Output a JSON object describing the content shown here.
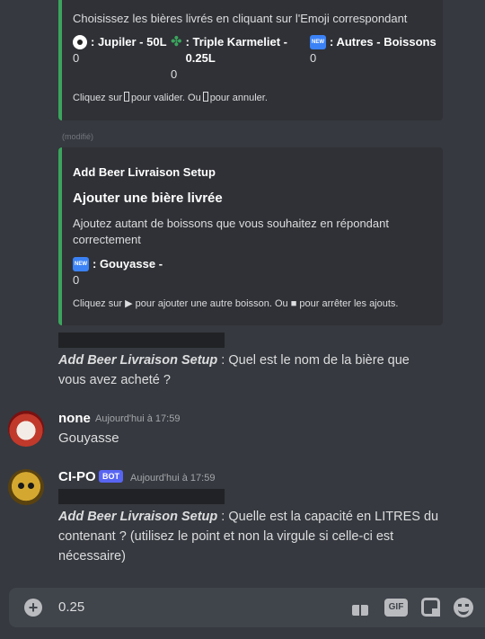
{
  "embed1": {
    "description": "Choisissez les bières livrés en cliquant sur l'Emoji correspondant",
    "fields": [
      {
        "icon": "soccer-ball-icon",
        "name": ": Jupiler - 50L",
        "value": "0"
      },
      {
        "icon": "four-leaf-clover-icon",
        "name": ": Triple Karmeliet - 0.25L",
        "value": "0"
      },
      {
        "icon": "new-button-icon",
        "name": ": Autres - Boissons",
        "value": "0"
      }
    ],
    "footer_a": "Cliquez sur",
    "footer_b": "pour valider. Ou",
    "footer_c": "pour annuler."
  },
  "modified_label": "(modifié)",
  "embed2": {
    "author": "Add Beer Livraison Setup",
    "title": "Ajouter une bière livrée",
    "description": "Ajoutez autant de boissons que vous souhaitez en répondant correctement",
    "field": {
      "icon": "new-button-icon",
      "name": ": Gouyasse -",
      "value": "0"
    },
    "footer_a": "Cliquez sur",
    "footer_play": "▶",
    "footer_b": "pour ajouter une autre boisson. Ou",
    "footer_stop": "■",
    "footer_c": "pour arrêter les ajouts."
  },
  "bot_prompt_1": {
    "bold": "Add Beer Livraison Setup",
    "text": " : Quel est le nom de la bière que vous avez acheté ?"
  },
  "message_none": {
    "username": "none",
    "timestamp": "Aujourd'hui à 17:59",
    "text": "Gouyasse"
  },
  "message_cipo": {
    "username": "CI-PO",
    "tag": "BOT",
    "timestamp": "Aujourd'hui à 17:59",
    "bold": "Add Beer Livraison Setup",
    "text": " : Quelle est la capacité en LITRES du contenant ? (utilisez le point et non la virgule si celle-ci est nécessaire)"
  },
  "composer": {
    "value": "0.25",
    "gif_label": "GIF"
  }
}
